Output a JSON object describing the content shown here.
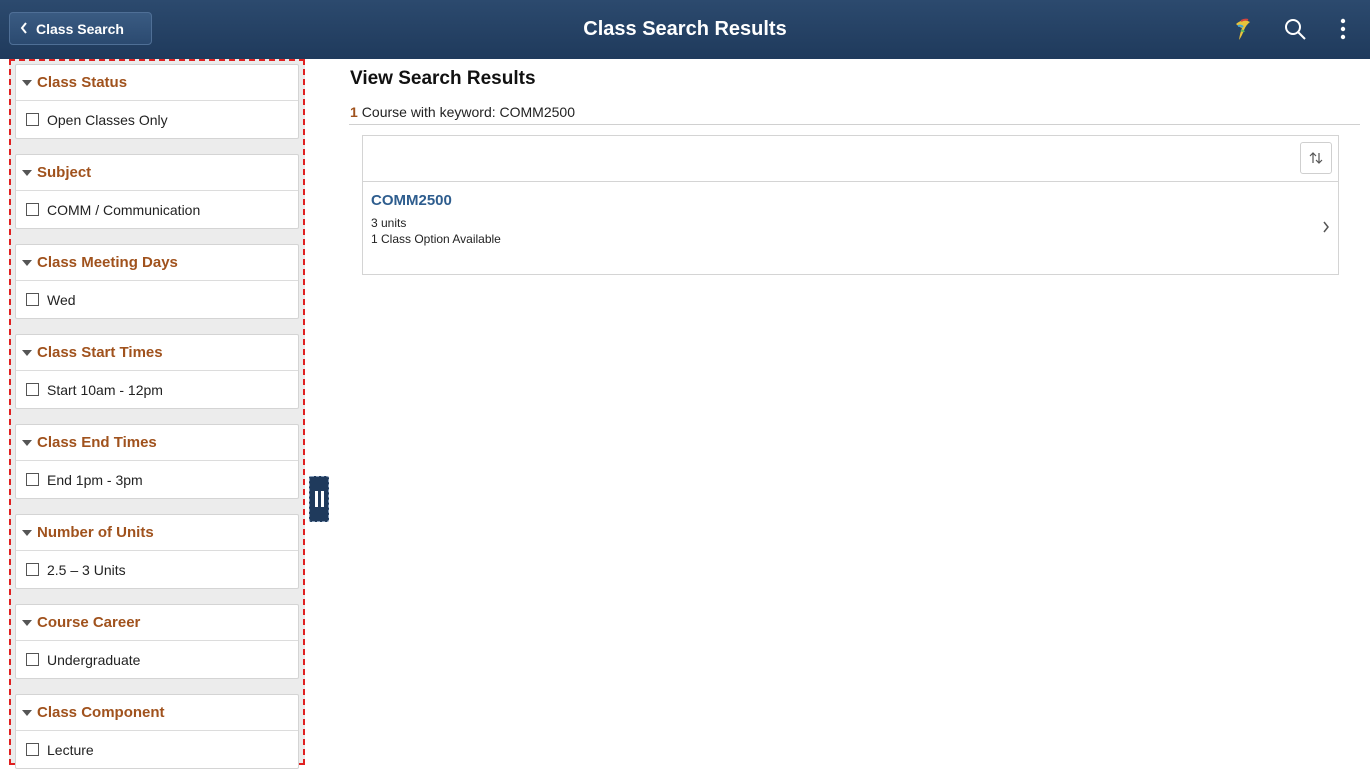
{
  "header": {
    "back_label": "Class Search",
    "title": "Class Search Results",
    "icons": [
      "logo-icon",
      "search-icon",
      "more-vertical-icon"
    ]
  },
  "sidebar": {
    "facets": [
      {
        "title": "Class Status",
        "option": "Open Classes Only"
      },
      {
        "title": "Subject",
        "option": "COMM / Communication"
      },
      {
        "title": "Class Meeting Days",
        "option": "Wed"
      },
      {
        "title": "Class Start Times",
        "option": "Start 10am - 12pm"
      },
      {
        "title": "Class End Times",
        "option": "End 1pm - 3pm"
      },
      {
        "title": "Number of Units",
        "option": "2.5 – 3 Units"
      },
      {
        "title": "Course Career",
        "option": "Undergraduate"
      },
      {
        "title": "Class Component",
        "option": "Lecture"
      }
    ]
  },
  "main": {
    "title": "View Search Results",
    "count": "1",
    "count_text": "Course with keyword: COMM2500",
    "results": [
      {
        "code": "COMM2500",
        "units": "3 units",
        "options": "1 Class Option Available"
      }
    ]
  },
  "colors": {
    "header_bg": "#1f3a5c",
    "facet_title": "#a0521d",
    "course_link": "#2e5d8e",
    "highlight_border": "#e02020"
  }
}
